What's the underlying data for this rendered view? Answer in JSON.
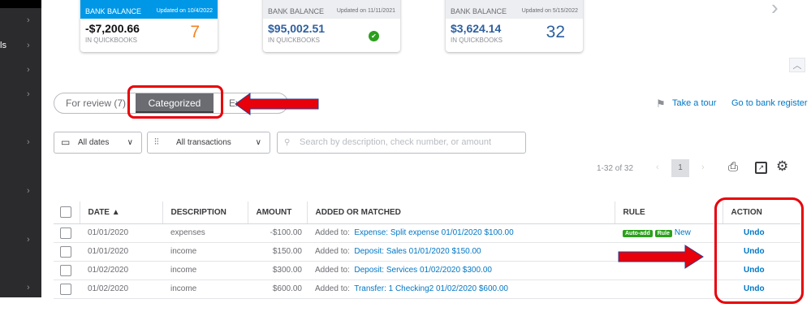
{
  "sidebar": {
    "partial_label": "ls"
  },
  "cards": [
    {
      "label": "BANK BALANCE",
      "updated": "Updated on 10/4/2022",
      "amount": "-$7,200.66",
      "sub": "IN QUICKBOOKS",
      "count": "7"
    },
    {
      "label": "BANK BALANCE",
      "updated": "Updated on 11/11/2021",
      "amount": "$95,002.51",
      "sub": "IN QUICKBOOKS"
    },
    {
      "label": "BANK BALANCE",
      "updated": "Updated on 5/15/2022",
      "amount": "$3,624.14",
      "sub": "IN QUICKBOOKS",
      "count": "32"
    }
  ],
  "tabs": {
    "for_review": "For review (7)",
    "categorized": "Categorized",
    "excluded": "Ex"
  },
  "links": {
    "tour": "Take a tour",
    "register": "Go to bank register"
  },
  "filters": {
    "dates": "All dates",
    "transactions": "All transactions",
    "search_placeholder": "Search by description, check number, or amount"
  },
  "pagination": {
    "range": "1-32 of 32",
    "page": "1"
  },
  "table": {
    "headers": [
      "DATE ▲",
      "DESCRIPTION",
      "AMOUNT",
      "ADDED OR MATCHED",
      "RULE",
      "ACTION"
    ],
    "rows": [
      {
        "date": "01/01/2020",
        "desc": "expenses",
        "amount": "-$100.00",
        "prefix": "Added to:",
        "match": "Expense: Split expense 01/01/2020 $100.00",
        "badge1": "Auto-add",
        "badge2": "Rule",
        "rule_link": "New",
        "action": "Undo"
      },
      {
        "date": "01/01/2020",
        "desc": "income",
        "amount": "$150.00",
        "prefix": "Added to:",
        "match": "Deposit: Sales 01/01/2020 $150.00",
        "action": "Undo"
      },
      {
        "date": "01/02/2020",
        "desc": "income",
        "amount": "$300.00",
        "prefix": "Added to:",
        "match": "Deposit: Services 01/02/2020 $300.00",
        "action": "Undo"
      },
      {
        "date": "01/02/2020",
        "desc": "income",
        "amount": "$600.00",
        "prefix": "Added to:",
        "match": "Transfer: 1 Checking2 01/02/2020 $600.00",
        "action": "Undo"
      }
    ]
  }
}
